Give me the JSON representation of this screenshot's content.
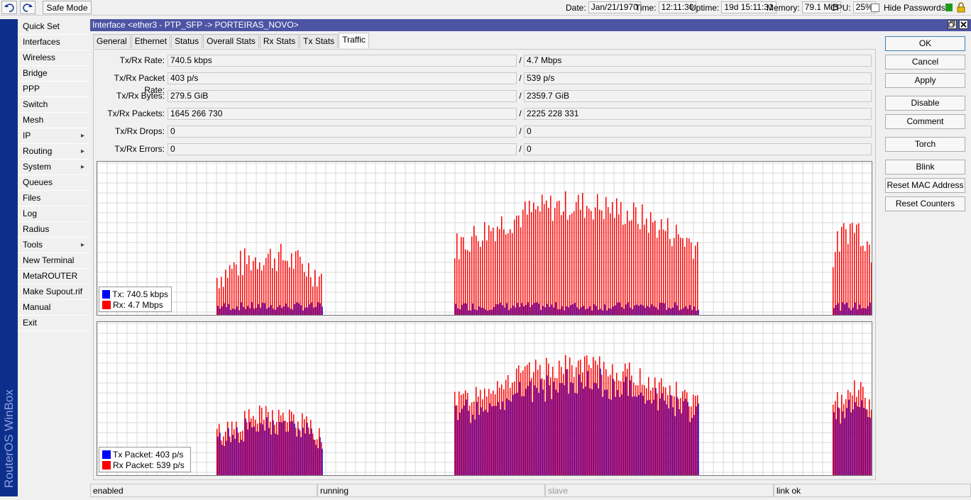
{
  "toolbar": {
    "undo_icon": "undo-icon",
    "redo_icon": "redo-icon",
    "safe_mode_label": "Safe Mode",
    "date_label": "Date:",
    "date_value": "Jan/21/1970",
    "time_label": "Time:",
    "time_value": "12:11:30",
    "uptime_label": "Uptime:",
    "uptime_value": "19d 15:11:31",
    "memory_label": "Memory:",
    "memory_value": "79.1 MiB",
    "cpu_label": "CPU:",
    "cpu_value": "25%",
    "hide_passwords_label": "Hide Passwords",
    "status_color": "#1e9b1e",
    "lock_icon": "lock-icon"
  },
  "brand": "RouterOS WinBox",
  "menu": [
    {
      "label": "Quick Set",
      "submenu": false
    },
    {
      "label": "Interfaces",
      "submenu": false
    },
    {
      "label": "Wireless",
      "submenu": false
    },
    {
      "label": "Bridge",
      "submenu": false
    },
    {
      "label": "PPP",
      "submenu": false
    },
    {
      "label": "Switch",
      "submenu": false
    },
    {
      "label": "Mesh",
      "submenu": false
    },
    {
      "label": "IP",
      "submenu": true
    },
    {
      "label": "Routing",
      "submenu": true
    },
    {
      "label": "System",
      "submenu": true
    },
    {
      "label": "Queues",
      "submenu": false
    },
    {
      "label": "Files",
      "submenu": false
    },
    {
      "label": "Log",
      "submenu": false
    },
    {
      "label": "Radius",
      "submenu": false
    },
    {
      "label": "Tools",
      "submenu": true
    },
    {
      "label": "New Terminal",
      "submenu": false
    },
    {
      "label": "MetaROUTER",
      "submenu": false
    },
    {
      "label": "Make Supout.rif",
      "submenu": false
    },
    {
      "label": "Manual",
      "submenu": false
    },
    {
      "label": "Exit",
      "submenu": false
    }
  ],
  "window": {
    "title": "Interface <ether3 - PTP_SFP -> PORTEIRAS_NOVO>",
    "tabs": [
      "General",
      "Ethernet",
      "Status",
      "Overall Stats",
      "Rx Stats",
      "Tx Stats",
      "Traffic"
    ],
    "active_tab": "Traffic",
    "fields": [
      {
        "label": "Tx/Rx Rate:",
        "tx": "740.5 kbps",
        "rx": "4.7 Mbps"
      },
      {
        "label": "Tx/Rx Packet Rate:",
        "tx": "403 p/s",
        "rx": "539 p/s"
      },
      {
        "label": "Tx/Rx Bytes:",
        "tx": "279.5 GiB",
        "rx": "2359.7 GiB"
      },
      {
        "label": "Tx/Rx Packets:",
        "tx": "1645 266 730",
        "rx": "2225 228 331"
      },
      {
        "label": "Tx/Rx Drops:",
        "tx": "0",
        "rx": "0"
      },
      {
        "label": "Tx/Rx Errors:",
        "tx": "0",
        "rx": "0"
      }
    ],
    "separator": "/",
    "buttons": [
      "OK",
      "Cancel",
      "Apply",
      "Disable",
      "Comment",
      "Torch",
      "Blink",
      "Reset MAC Address",
      "Reset Counters"
    ],
    "status": [
      "enabled",
      "running",
      "slave",
      "link ok"
    ]
  },
  "graphs": {
    "tx_color": "#0000ff",
    "rx_color": "#ff0000",
    "traffic": {
      "legend": [
        {
          "label": "Tx:",
          "value": "740.5 kbps"
        },
        {
          "label": "Rx:",
          "value": "4.7 Mbps"
        }
      ]
    },
    "packets": {
      "legend": [
        {
          "label": "Tx Packet:",
          "value": "403 p/s"
        },
        {
          "label": "Rx Packet:",
          "value": "539 p/s"
        }
      ]
    }
  }
}
